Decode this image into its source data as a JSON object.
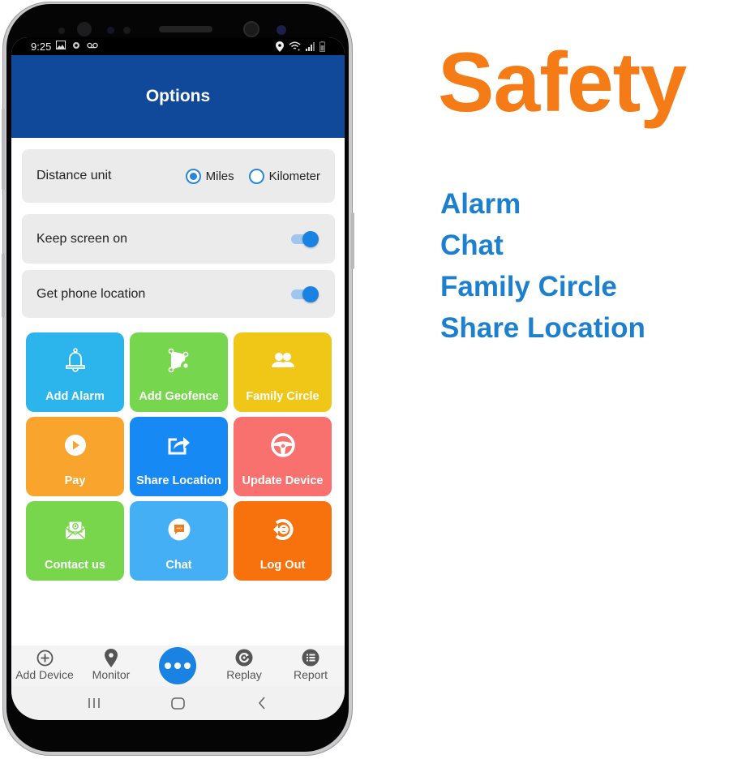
{
  "statusbar": {
    "time": "9:25",
    "left_icons": [
      "gallery-icon",
      "sync-icon",
      "voicemail-icon"
    ],
    "right_icons": [
      "location-icon",
      "wifi-icon",
      "signal-icon",
      "battery-icon"
    ]
  },
  "appbar": {
    "title": "Options"
  },
  "settings": {
    "distance_unit": {
      "label": "Distance unit",
      "options": [
        {
          "label": "Miles",
          "selected": true
        },
        {
          "label": "Kilometer",
          "selected": false
        }
      ]
    },
    "keep_screen_on": {
      "label": "Keep screen on",
      "enabled": true
    },
    "get_phone_location": {
      "label": "Get phone location",
      "enabled": true
    }
  },
  "tiles": [
    {
      "label": "Add Alarm",
      "icon": "bell-icon",
      "color": "#2bb5ec"
    },
    {
      "label": "Add Geofence",
      "icon": "geofence-add-icon",
      "color": "#76d64d"
    },
    {
      "label": "Family Circle",
      "icon": "people-icon",
      "color": "#f1c717"
    },
    {
      "label": "Pay",
      "icon": "play-circle-icon",
      "color": "#f8a42d"
    },
    {
      "label": "Share Location",
      "icon": "share-icon",
      "color": "#1689f5"
    },
    {
      "label": "Update Device",
      "icon": "steering-wheel-icon",
      "color": "#f8716f"
    },
    {
      "label": "Contact us",
      "icon": "envelope-at-icon",
      "color": "#77d64c"
    },
    {
      "label": "Chat",
      "icon": "chat-bubble-icon",
      "color": "#45aff5"
    },
    {
      "label": "Log Out",
      "icon": "logout-icon",
      "color": "#f7720c"
    }
  ],
  "bottomnav": {
    "items": [
      {
        "label": "Add Device",
        "icon": "plus-circle-icon"
      },
      {
        "label": "Monitor",
        "icon": "map-pin-icon"
      },
      {
        "label": "",
        "icon": "more-dots-icon"
      },
      {
        "label": "Replay",
        "icon": "replay-icon"
      },
      {
        "label": "Report",
        "icon": "list-icon"
      }
    ],
    "accent": "#1a82e2"
  },
  "system_nav": [
    "recents-button",
    "home-button",
    "back-button"
  ],
  "marketing": {
    "headline": "Safety",
    "headline_color": "#f47b16",
    "features": [
      "Alarm",
      "Chat",
      "Family Circle",
      "Share Location"
    ],
    "features_color": "#1d80cf"
  }
}
